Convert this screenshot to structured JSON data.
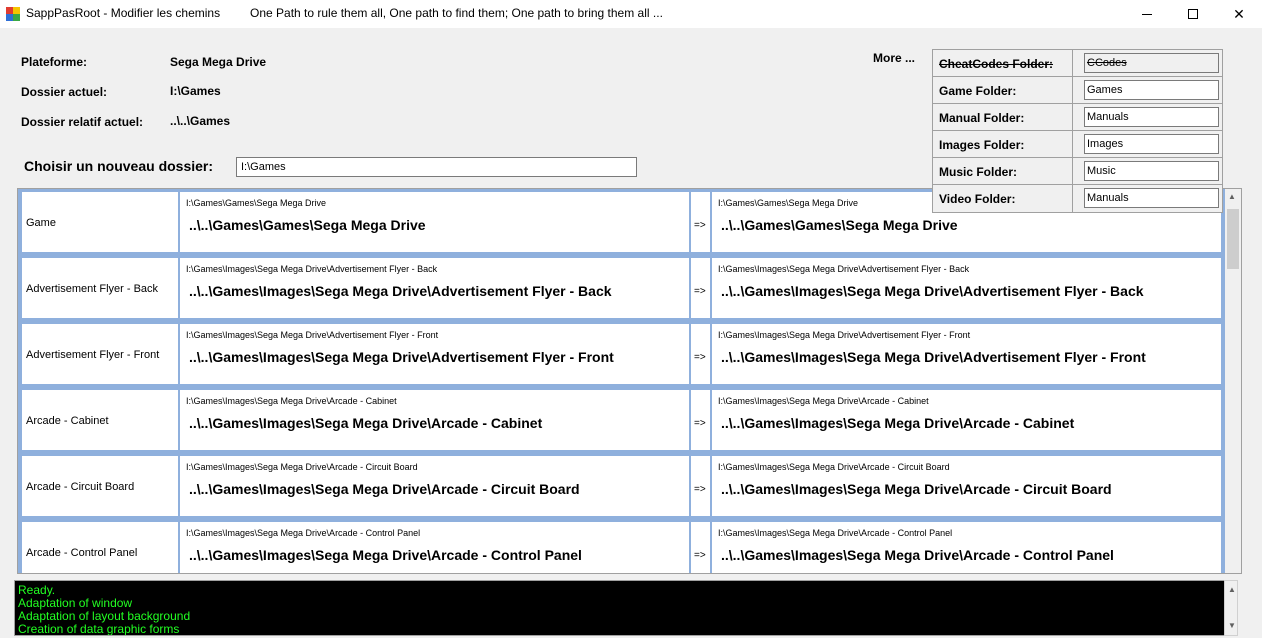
{
  "window": {
    "title": "SappPasRoot - Modifier les chemins",
    "slogan": "One Path to rule them all, One path to find them; One path to bring them all ...",
    "controls": {
      "minimize": "",
      "maximize": "",
      "close": "✕"
    }
  },
  "info": {
    "platform_label": "Plateforme:",
    "platform_value": "Sega Mega Drive",
    "current_folder_label": "Dossier actuel:",
    "current_folder_value": "I:\\Games",
    "relative_folder_label": "Dossier relatif actuel:",
    "relative_folder_value": "..\\..\\Games"
  },
  "chooser": {
    "label": "Choisir un nouveau dossier:",
    "value": "I:\\Games"
  },
  "more": {
    "label": "More ..."
  },
  "folders": [
    {
      "label": "CheatCodes Folder:",
      "value": "CCodes",
      "disabled": true
    },
    {
      "label": "Game Folder:",
      "value": "Games"
    },
    {
      "label": "Manual Folder:",
      "value": "Manuals"
    },
    {
      "label": "Images Folder:",
      "value": "Images"
    },
    {
      "label": "Music Folder:",
      "value": "Music"
    },
    {
      "label": "Video Folder:",
      "value": "Manuals"
    }
  ],
  "rows": [
    {
      "name": "Game",
      "src_full": "I:\\Games\\Games\\Sega Mega Drive",
      "src_rel": "..\\..\\Games\\Games\\Sega Mega Drive",
      "arrow": "=>",
      "dst_full": "I:\\Games\\Games\\Sega Mega Drive",
      "dst_rel": "..\\..\\Games\\Games\\Sega Mega Drive"
    },
    {
      "name": "Advertisement Flyer - Back",
      "src_full": "I:\\Games\\Images\\Sega Mega Drive\\Advertisement Flyer - Back",
      "src_rel": "..\\..\\Games\\Images\\Sega Mega Drive\\Advertisement Flyer - Back",
      "arrow": "=>",
      "dst_full": "I:\\Games\\Images\\Sega Mega Drive\\Advertisement Flyer - Back",
      "dst_rel": "..\\..\\Games\\Images\\Sega Mega Drive\\Advertisement Flyer - Back"
    },
    {
      "name": "Advertisement Flyer - Front",
      "src_full": "I:\\Games\\Images\\Sega Mega Drive\\Advertisement Flyer - Front",
      "src_rel": "..\\..\\Games\\Images\\Sega Mega Drive\\Advertisement Flyer - Front",
      "arrow": "=>",
      "dst_full": "I:\\Games\\Images\\Sega Mega Drive\\Advertisement Flyer - Front",
      "dst_rel": "..\\..\\Games\\Images\\Sega Mega Drive\\Advertisement Flyer - Front"
    },
    {
      "name": "Arcade - Cabinet",
      "src_full": "I:\\Games\\Images\\Sega Mega Drive\\Arcade - Cabinet",
      "src_rel": "..\\..\\Games\\Images\\Sega Mega Drive\\Arcade - Cabinet",
      "arrow": "=>",
      "dst_full": "I:\\Games\\Images\\Sega Mega Drive\\Arcade - Cabinet",
      "dst_rel": "..\\..\\Games\\Images\\Sega Mega Drive\\Arcade - Cabinet"
    },
    {
      "name": "Arcade - Circuit Board",
      "src_full": "I:\\Games\\Images\\Sega Mega Drive\\Arcade - Circuit Board",
      "src_rel": "..\\..\\Games\\Images\\Sega Mega Drive\\Arcade - Circuit Board",
      "arrow": "=>",
      "dst_full": "I:\\Games\\Images\\Sega Mega Drive\\Arcade - Circuit Board",
      "dst_rel": "..\\..\\Games\\Images\\Sega Mega Drive\\Arcade - Circuit Board"
    },
    {
      "name": "Arcade - Control Panel",
      "src_full": "I:\\Games\\Images\\Sega Mega Drive\\Arcade - Control Panel",
      "src_rel": "..\\..\\Games\\Images\\Sega Mega Drive\\Arcade - Control Panel",
      "arrow": "=>",
      "dst_full": "I:\\Games\\Images\\Sega Mega Drive\\Arcade - Control Panel",
      "dst_rel": "..\\..\\Games\\Images\\Sega Mega Drive\\Arcade - Control Panel"
    }
  ],
  "log": [
    "Ready.",
    "Adaptation of window",
    "Adaptation of layout background",
    "Creation of data graphic forms"
  ],
  "colors": {
    "grid_accent": "#8fb0dd",
    "log_text": "#22ff22",
    "log_bg": "#000000"
  }
}
